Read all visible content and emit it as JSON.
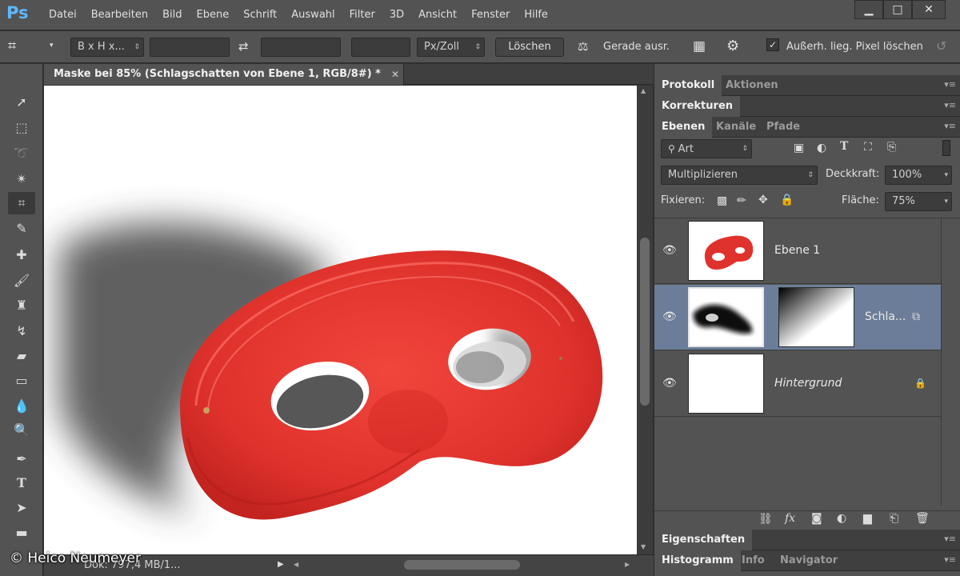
{
  "app": {
    "logo": "Ps"
  },
  "menu": [
    "Datei",
    "Bearbeiten",
    "Bild",
    "Ebene",
    "Schrift",
    "Auswahl",
    "Filter",
    "3D",
    "Ansicht",
    "Fenster",
    "Hilfe"
  ],
  "options": {
    "ratio_select": "B x H x...",
    "unit_select": "Px/Zoll",
    "clear_button": "Löschen",
    "straighten_label": "Gerade ausr.",
    "delete_cropped_label": "Außerh. lieg. Pixel löschen",
    "delete_cropped_checked": true
  },
  "document": {
    "tab_title": "Maske bei 85% (Schlagschatten von Ebene 1, RGB/8#) *",
    "status_text": "Dok: 797,4 MB/1...",
    "watermark": "© Heico Neumeyer"
  },
  "panels": {
    "group1": {
      "tabs": [
        "Protokoll",
        "Aktionen"
      ],
      "active": 0
    },
    "group2": {
      "tabs": [
        "Korrekturen"
      ],
      "active": 0
    },
    "layers": {
      "tabs": [
        "Ebenen",
        "Kanäle",
        "Pfade"
      ],
      "filter_select": "Art",
      "blend_mode": "Multiplizieren",
      "opacity_label": "Deckkraft:",
      "opacity_value": "100%",
      "lock_label": "Fixieren:",
      "fill_label": "Fläche:",
      "fill_value": "75%",
      "rows": [
        {
          "name": "Ebene 1",
          "selected": false,
          "italic": false
        },
        {
          "name": "Schla...",
          "selected": true,
          "italic": false
        },
        {
          "name": "Hintergrund",
          "selected": false,
          "italic": true
        }
      ]
    },
    "group4": {
      "tabs": [
        "Eigenschaften"
      ],
      "active": 0
    },
    "group5": {
      "tabs": [
        "Histogramm",
        "Info",
        "Navigator"
      ],
      "active": 0
    }
  },
  "colors": {
    "accent_selected": "#6b7d98",
    "mask_red": "#e0322c",
    "ps_blue": "#5fb7ff"
  }
}
